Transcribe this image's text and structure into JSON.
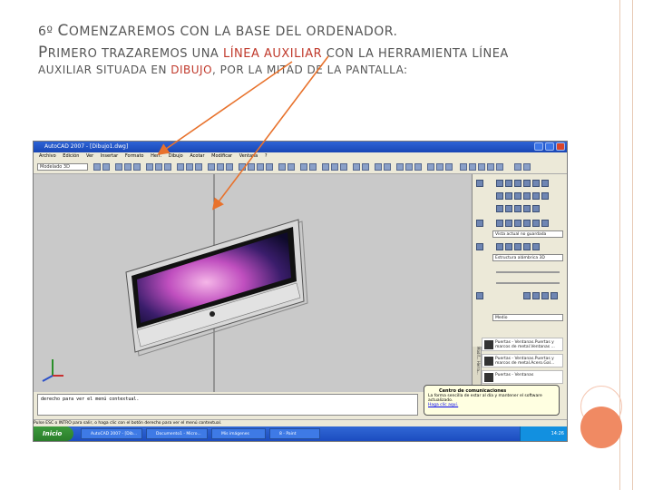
{
  "slide": {
    "line1_big_a": "6",
    "line1_rest_a": "º ",
    "line1_big_b": "C",
    "line1_rest_b": "OMENZAREMOS CON LA BASE DEL ORDENADOR.",
    "line2_big": "P",
    "line2_a": "RIMERO TRAZAREMOS UNA ",
    "line2_red": "LÍNEA AUXILIAR",
    "line2_b": " CON LA HERRAMIENTA LÍNEA",
    "line3_a": "AUXILIAR SITUADA EN ",
    "line3_red": "DIBUJO",
    "line3_b": ", POR LA MITAD DE LA PANTALLA:"
  },
  "colors": {
    "accent_red": "#c0392b",
    "arrow_orange": "#e8722c",
    "circle_orange": "#f08a63"
  },
  "window": {
    "title": "AutoCAD 2007 - [Dibujo1.dwg]",
    "menus": [
      "Archivo",
      "Edición",
      "Ver",
      "Insertar",
      "Formato",
      "Herr.",
      "Dibujo",
      "Acotar",
      "Modificar",
      "Ventana",
      "?"
    ],
    "workspace": "Modelado 3D",
    "panel": {
      "view_select": "Vista actual no guardada",
      "style_select": "Estructura alámbrica 3D",
      "quality_select": "Medio",
      "tools": [
        "Puertas - Ventanas.Puertas y marcos de metal.Ventanas ...",
        "Puertas - Ventanas.Puertas y marcos de metal.Acero.Gal...",
        "Puertas - Ventanas"
      ],
      "palette_tabs": "Modif...  Herra..."
    },
    "command_line": "derecho para ver el menú contextual.",
    "status": "Pulse ESC o INTRO para salir, o haga clic con el botón derecho para ver el menú contextual.",
    "balloon": {
      "title": "Centro de comunicaciones",
      "text": "La forma sencilla de estar al día y mantener el software actualizado.",
      "link": "Haga clic aquí."
    },
    "taskbar": {
      "start": "Inicio",
      "tasks": [
        "AutoCAD 2007 - [Dib...",
        "Documento1 - Micro...",
        "Mis imágenes",
        "8 - Paint"
      ],
      "clock": "14:26"
    }
  }
}
